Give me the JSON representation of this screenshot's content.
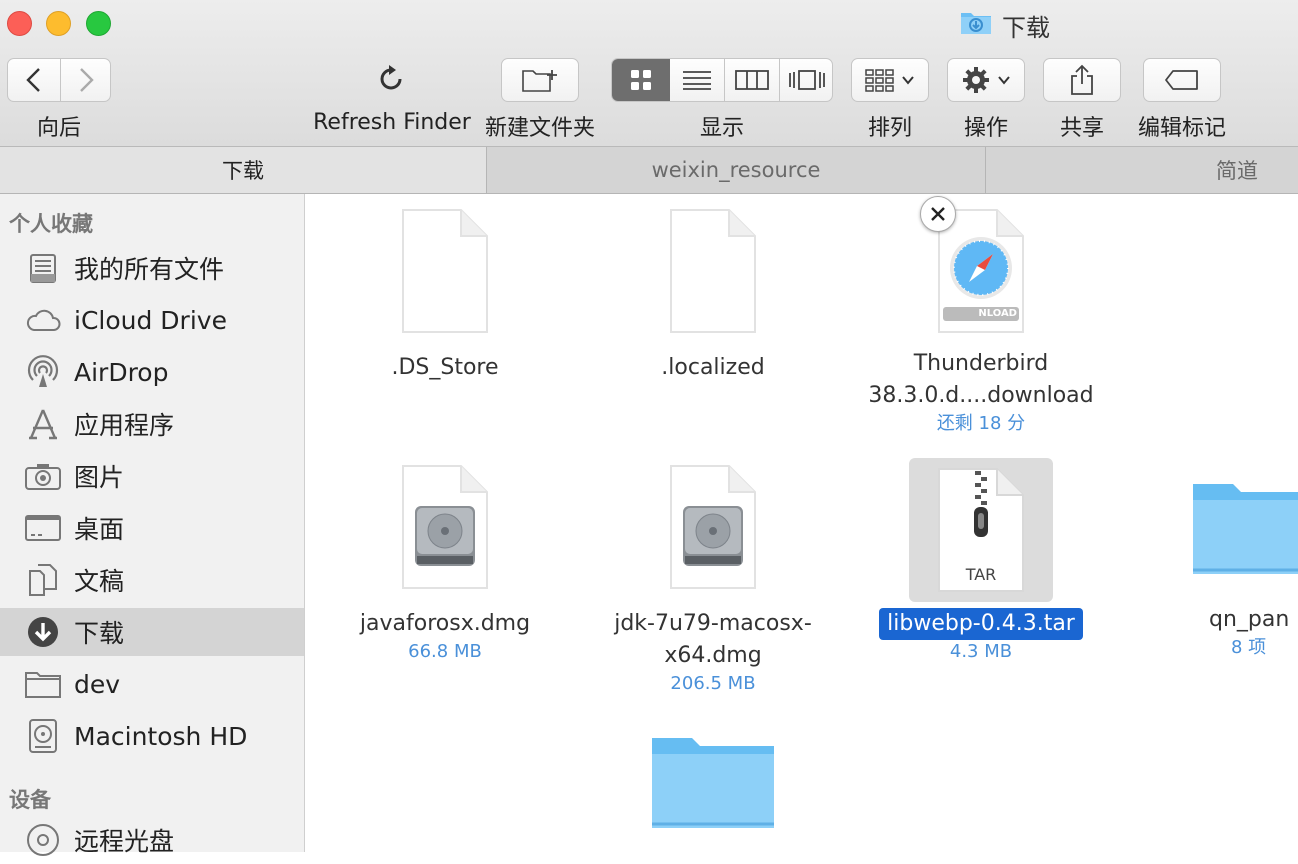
{
  "window": {
    "title": "下载"
  },
  "toolbar": {
    "back_label": "向后",
    "refresh_label": "Refresh Finder",
    "new_folder_label": "新建文件夹",
    "view_label": "显示",
    "arrange_label": "排列",
    "action_label": "操作",
    "share_label": "共享",
    "tags_label": "编辑标记"
  },
  "tabs": [
    {
      "label": "下载",
      "active": true
    },
    {
      "label": "weixin_resource",
      "active": false
    },
    {
      "label": "简道",
      "active": false
    }
  ],
  "sidebar": {
    "favorites_header": "个人收藏",
    "items": [
      {
        "label": "我的所有文件",
        "icon": "all-files-icon"
      },
      {
        "label": "iCloud Drive",
        "icon": "cloud-icon"
      },
      {
        "label": "AirDrop",
        "icon": "airdrop-icon"
      },
      {
        "label": "应用程序",
        "icon": "applications-icon"
      },
      {
        "label": "图片",
        "icon": "camera-icon"
      },
      {
        "label": "桌面",
        "icon": "desktop-icon"
      },
      {
        "label": "文稿",
        "icon": "documents-icon"
      },
      {
        "label": "下载",
        "icon": "download-icon",
        "selected": true
      },
      {
        "label": "dev",
        "icon": "folder-icon"
      },
      {
        "label": "Macintosh HD",
        "icon": "hard-drive-icon"
      }
    ],
    "devices_header": "设备",
    "device_items": [
      {
        "label": "远程光盘",
        "icon": "remote-disc-icon"
      }
    ]
  },
  "files": [
    {
      "name": ".DS_Store",
      "sub": "",
      "icon": "blank-document-icon"
    },
    {
      "name": ".localized",
      "sub": "",
      "icon": "blank-document-icon"
    },
    {
      "name": "Thunderbird",
      "name2": "38.3.0.d....download",
      "sub": "还剩 18 分",
      "icon": "safari-download-icon",
      "badge": "NLOAD"
    },
    {
      "name": "javaforosx.dmg",
      "sub": "66.8 MB",
      "icon": "disk-image-icon"
    },
    {
      "name": "jdk-7u79-macosx-",
      "name2": "x64.dmg",
      "sub": "206.5 MB",
      "icon": "disk-image-icon"
    },
    {
      "name": "libwebp-0.4.3.tar",
      "sub": "4.3 MB",
      "icon": "tar-archive-icon",
      "badge": "TAR",
      "selected": true
    },
    {
      "name": "qn_pan",
      "sub": "8 项",
      "icon": "folder-icon"
    },
    {
      "name": "",
      "sub": "",
      "icon": "folder-icon"
    }
  ],
  "colors": {
    "selection": "#1a66d2",
    "subtext": "#4a90d9",
    "folder": "#6cbff4"
  }
}
